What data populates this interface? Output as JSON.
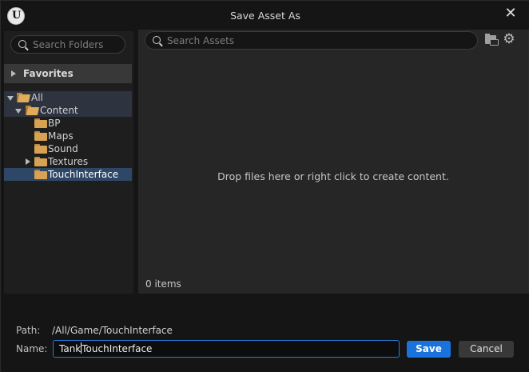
{
  "window": {
    "title": "Save Asset As",
    "logo_icon": "unreal-logo-icon",
    "close_icon": "close-icon",
    "close_glyph": "✕"
  },
  "left_pane": {
    "search_placeholder": "Search Folders",
    "favorites_label": "Favorites",
    "tree": [
      {
        "label": "All",
        "depth": 0,
        "expanded": true
      },
      {
        "label": "Content",
        "depth": 1,
        "expanded": true
      },
      {
        "label": "BP",
        "depth": 2
      },
      {
        "label": "Maps",
        "depth": 2
      },
      {
        "label": "Sound",
        "depth": 2
      },
      {
        "label": "Textures",
        "depth": 2,
        "collapsed_children": true
      },
      {
        "label": "TouchInterface",
        "depth": 2,
        "selected": true
      }
    ]
  },
  "right_pane": {
    "search_placeholder": "Search Assets",
    "empty_message": "Drop files here or right click to create content.",
    "item_count": "0 items",
    "gear_glyph": "⚙"
  },
  "footer": {
    "path_label": "Path:",
    "path_value": "/All/Game/TouchInterface",
    "name_label": "Name:",
    "name_value_before_caret": "Tank",
    "name_value_after_caret": "TouchInterface",
    "save_label": "Save",
    "cancel_label": "Cancel"
  },
  "colors": {
    "accent": "#1a73dd",
    "selection": "#2f4766",
    "folder": "#d7a253"
  }
}
